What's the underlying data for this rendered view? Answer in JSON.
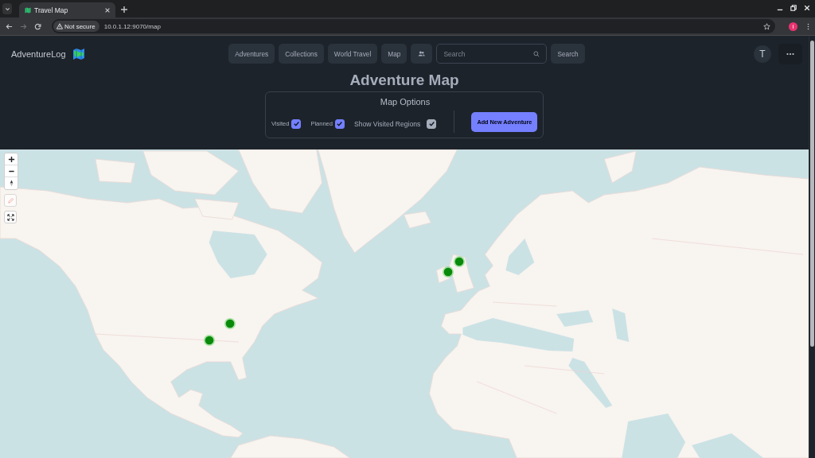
{
  "browser": {
    "tabs": [
      {
        "title": "Travel Map",
        "selected": true
      }
    ],
    "security": "Not secure",
    "url": "10.0.1.12:9070/map"
  },
  "navbar": {
    "brand": "AdventureLog",
    "links": [
      "Adventures",
      "Collections",
      "World Travel",
      "Map"
    ],
    "search": {
      "placeholder": "Search"
    },
    "search_button": "Search",
    "avatar": "T"
  },
  "title": "Adventure Map",
  "map_options": {
    "title": "Map Options",
    "toggles": [
      {
        "label": "Visited",
        "checked": true,
        "kind": "primary"
      },
      {
        "label": "Planned",
        "checked": true,
        "kind": "primary"
      },
      {
        "label": "Show Visited Regions",
        "checked": true,
        "kind": "plain"
      }
    ],
    "add_button": "Add New Adventure"
  },
  "map": {
    "markers": [
      {
        "kind": "visited"
      },
      {
        "kind": "visited"
      },
      {
        "kind": "visited"
      },
      {
        "kind": "visited"
      }
    ]
  }
}
